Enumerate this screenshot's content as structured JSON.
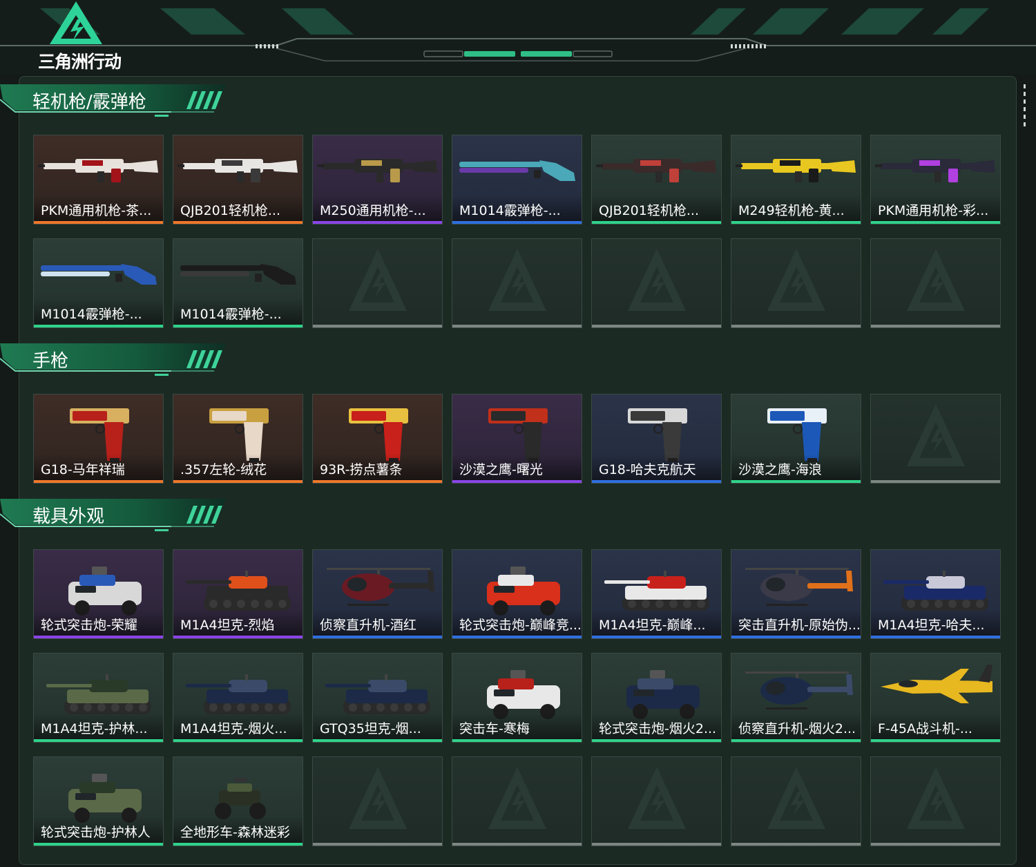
{
  "header": {
    "game_title": "三角洲行动"
  },
  "colors": {
    "accent": "#2fd38a",
    "quality_orange": "#f0782a",
    "quality_purple": "#8a45e8",
    "quality_blue": "#2f6fe0",
    "quality_green": "#2fd38a",
    "empty_slot": "#7d8682"
  },
  "sections": [
    {
      "title": "轻机枪/霰弹枪",
      "rows": [
        [
          {
            "name": "PKM通用机枪-茶...",
            "quality": "orange",
            "icon": "machine-gun-icon",
            "art": "lmg",
            "palette": [
              "#e8e2dc",
              "#a3131a"
            ]
          },
          {
            "name": "QJB201轻机枪...",
            "quality": "orange",
            "icon": "machine-gun-icon",
            "art": "lmg",
            "palette": [
              "#e8e6e2",
              "#3a3a3a"
            ]
          },
          {
            "name": "M250通用机枪-...",
            "quality": "purple",
            "icon": "machine-gun-icon",
            "art": "lmg",
            "palette": [
              "#2a2a2a",
              "#b89a4a"
            ]
          },
          {
            "name": "M1014霰弹枪-...",
            "quality": "blue",
            "icon": "shotgun-icon",
            "art": "shotgun",
            "palette": [
              "#4aa8b8",
              "#6a3aa8"
            ]
          },
          {
            "name": "QJB201轻机枪...",
            "quality": "green",
            "icon": "machine-gun-icon",
            "art": "lmg",
            "palette": [
              "#3a2a2a",
              "#c0403a"
            ]
          },
          {
            "name": "M249轻机枪-黄...",
            "quality": "green",
            "icon": "machine-gun-icon",
            "art": "lmg",
            "palette": [
              "#e8c820",
              "#1a1a1a"
            ]
          },
          {
            "name": "PKM通用机枪-彩...",
            "quality": "green",
            "icon": "machine-gun-icon",
            "art": "lmg",
            "palette": [
              "#2a2a3a",
              "#b040e0"
            ]
          }
        ],
        [
          {
            "name": "M1014霰弹枪-...",
            "quality": "green",
            "icon": "shotgun-icon",
            "art": "shotgun",
            "palette": [
              "#2a5ab8",
              "#cfe2f0"
            ]
          },
          {
            "name": "M1014霰弹枪-...",
            "quality": "green",
            "icon": "shotgun-icon",
            "art": "shotgun",
            "palette": [
              "#1c1c1c",
              "#3a3a3a"
            ]
          },
          {
            "name": "",
            "quality": "empty"
          },
          {
            "name": "",
            "quality": "empty"
          },
          {
            "name": "",
            "quality": "empty"
          },
          {
            "name": "",
            "quality": "empty"
          },
          {
            "name": "",
            "quality": "empty"
          }
        ]
      ]
    },
    {
      "title": "手枪",
      "rows": [
        [
          {
            "name": "G18-马年祥瑞",
            "quality": "orange",
            "icon": "pistol-icon",
            "art": "pistol",
            "palette": [
              "#b8201a",
              "#d8b060"
            ]
          },
          {
            "name": ".357左轮-绒花",
            "quality": "orange",
            "icon": "revolver-icon",
            "art": "pistol",
            "palette": [
              "#e8d8c8",
              "#c8a040"
            ]
          },
          {
            "name": "93R-捞点薯条",
            "quality": "orange",
            "icon": "pistol-icon",
            "art": "pistol",
            "palette": [
              "#c8201a",
              "#e8c040"
            ]
          },
          {
            "name": "沙漠之鹰-曙光",
            "quality": "purple",
            "icon": "pistol-icon",
            "art": "pistol",
            "palette": [
              "#2a2a2a",
              "#c0301a"
            ]
          },
          {
            "name": "G18-哈夫克航天",
            "quality": "blue",
            "icon": "pistol-icon",
            "art": "pistol",
            "palette": [
              "#3a3a3a",
              "#d8d8d8"
            ]
          },
          {
            "name": "沙漠之鹰-海浪",
            "quality": "green",
            "icon": "pistol-icon",
            "art": "pistol",
            "palette": [
              "#1c58b8",
              "#e8f0f8"
            ]
          },
          {
            "name": "",
            "quality": "empty"
          }
        ]
      ]
    },
    {
      "title": "载具外观",
      "rows": [
        [
          {
            "name": "轮式突击炮-荣耀",
            "quality": "purple",
            "icon": "armored-car-icon",
            "art": "car",
            "palette": [
              "#d8d8d8",
              "#2a5ab8"
            ]
          },
          {
            "name": "M1A4坦克-烈焰",
            "quality": "purple",
            "icon": "tank-icon",
            "art": "tank",
            "palette": [
              "#2a2a2a",
              "#e0501a"
            ]
          },
          {
            "name": "侦察直升机-酒红",
            "quality": "blue",
            "icon": "helicopter-icon",
            "art": "heli",
            "palette": [
              "#6a1a22",
              "#2a2a2a"
            ]
          },
          {
            "name": "轮式突击炮-巅峰竞...",
            "quality": "blue",
            "icon": "armored-car-icon",
            "art": "car",
            "palette": [
              "#d8301a",
              "#e8e8e8"
            ]
          },
          {
            "name": "M1A4坦克-巅峰...",
            "quality": "blue",
            "icon": "tank-icon",
            "art": "tank",
            "palette": [
              "#e8e8e8",
              "#c8201a"
            ]
          },
          {
            "name": "突击直升机-原始伪...",
            "quality": "blue",
            "icon": "helicopter-icon",
            "art": "heli",
            "palette": [
              "#3a3a48",
              "#e0701a"
            ]
          },
          {
            "name": "M1A4坦克-哈夫...",
            "quality": "blue",
            "icon": "tank-icon",
            "art": "tank",
            "palette": [
              "#1a2a68",
              "#c8c8d8"
            ]
          }
        ],
        [
          {
            "name": "M1A4坦克-护林...",
            "quality": "green",
            "icon": "tank-icon",
            "art": "tank",
            "palette": [
              "#5a6a48",
              "#2a3a28"
            ]
          },
          {
            "name": "M1A4坦克-烟火...",
            "quality": "green",
            "icon": "tank-icon",
            "art": "tank",
            "palette": [
              "#1c2a48",
              "#3a4a68"
            ]
          },
          {
            "name": "GTQ35坦克-烟...",
            "quality": "green",
            "icon": "tank-icon",
            "art": "tank",
            "palette": [
              "#1c2a48",
              "#3a4a68"
            ]
          },
          {
            "name": "突击车-寒梅",
            "quality": "green",
            "icon": "armored-car-icon",
            "art": "car",
            "palette": [
              "#e8e8e8",
              "#b8201a"
            ]
          },
          {
            "name": "轮式突击炮-烟火2...",
            "quality": "green",
            "icon": "armored-car-icon",
            "art": "car",
            "palette": [
              "#1c2a48",
              "#3a4a68"
            ]
          },
          {
            "name": "侦察直升机-烟火2...",
            "quality": "green",
            "icon": "helicopter-icon",
            "art": "heli",
            "palette": [
              "#1c2a48",
              "#3a4a68"
            ]
          },
          {
            "name": "F-45A战斗机-...",
            "quality": "green",
            "icon": "fighter-jet-icon",
            "art": "jet",
            "palette": [
              "#e8b820",
              "#2a2a2a"
            ]
          }
        ],
        [
          {
            "name": "轮式突击炮-护林人",
            "quality": "green",
            "icon": "armored-car-icon",
            "art": "car",
            "palette": [
              "#5a6a48",
              "#2a3a28"
            ]
          },
          {
            "name": "全地形车-森林迷彩",
            "quality": "green",
            "icon": "atv-icon",
            "art": "atv",
            "palette": [
              "#2a3024",
              "#4a5a3a"
            ]
          },
          {
            "name": "",
            "quality": "empty"
          },
          {
            "name": "",
            "quality": "empty"
          },
          {
            "name": "",
            "quality": "empty"
          },
          {
            "name": "",
            "quality": "empty"
          },
          {
            "name": "",
            "quality": "empty"
          }
        ]
      ]
    }
  ]
}
